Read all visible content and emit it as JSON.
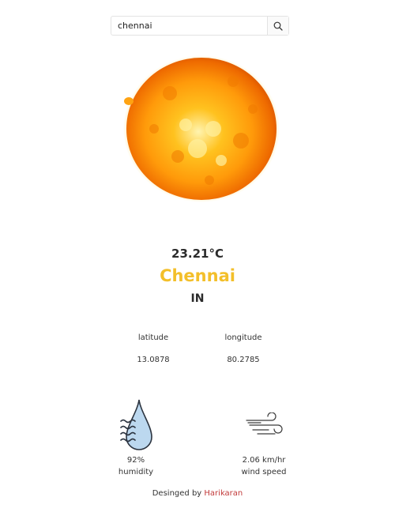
{
  "search": {
    "value": "chennai"
  },
  "weather": {
    "temperature": "23.21°C",
    "city": "Chennai",
    "country": "IN"
  },
  "coordinates": {
    "latitude_label": "latitude",
    "longitude_label": "longitude",
    "latitude_value": "13.0878",
    "longitude_value": "80.2785"
  },
  "stats": {
    "humidity_value": "92%",
    "humidity_label": "humidity",
    "wind_value": "2.06 km/hr",
    "wind_label": "wind speed"
  },
  "footer": {
    "prefix": "Desinged by",
    "author": "Harikaran"
  },
  "icons": {
    "search": "search-icon",
    "weather": "sun-icon",
    "humidity": "humidity-drop-icon",
    "wind": "wind-icon"
  },
  "colors": {
    "city": "#f3bf2a",
    "author_link": "#c23b3b"
  }
}
